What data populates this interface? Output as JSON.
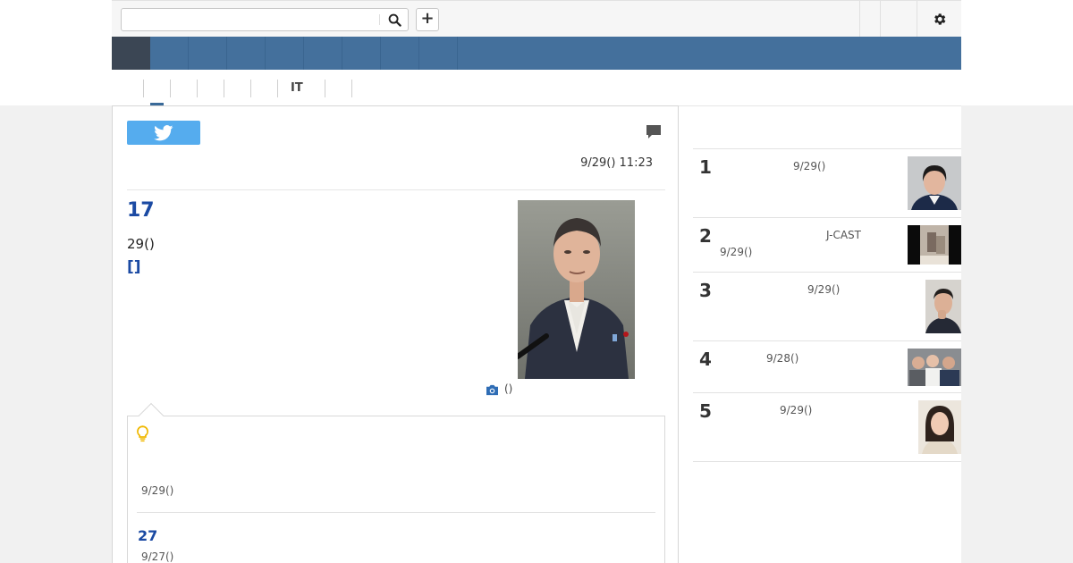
{
  "search": {
    "placeholder": "",
    "value": ""
  },
  "header": {
    "plus_label": "+"
  },
  "nav": {
    "item_count": 9
  },
  "subtabs": [
    "",
    "",
    "",
    "",
    "",
    "IT",
    "",
    ""
  ],
  "article": {
    "datetime": "9/29() 11:23",
    "headline": "17",
    "lead": "29()",
    "more_link": "[]",
    "photo_caption": "()"
  },
  "related": {
    "date1": "9/29()",
    "title2": "27",
    "date2": "9/27()"
  },
  "ranking": [
    {
      "rank": "1",
      "source": "",
      "date": "9/29()"
    },
    {
      "rank": "2",
      "source": "J-CAST",
      "date": "9/29()"
    },
    {
      "rank": "3",
      "source": "",
      "date": "9/29()"
    },
    {
      "rank": "4",
      "source": "",
      "date": "9/28()"
    },
    {
      "rank": "5",
      "source": "",
      "date": "9/29()"
    }
  ],
  "icons": {
    "search": "search-icon",
    "gear": "gear-icon",
    "twitter": "twitter-bird-icon",
    "comment": "comment-icon",
    "camera": "camera-icon",
    "bulb": "lightbulb-icon"
  },
  "colors": {
    "nav_bar": "#44709c",
    "nav_active": "#3b4654",
    "link_blue": "#1b4aa3",
    "twitter": "#55acee",
    "bulb": "#f0b800"
  }
}
